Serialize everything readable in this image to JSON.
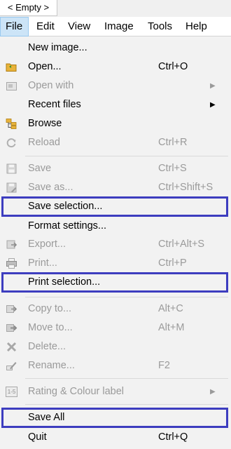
{
  "tab": {
    "label": "< Empty >"
  },
  "menubar": {
    "items": [
      {
        "label": "File"
      },
      {
        "label": "Edit"
      },
      {
        "label": "View"
      },
      {
        "label": "Image"
      },
      {
        "label": "Tools"
      },
      {
        "label": "Help"
      }
    ]
  },
  "file_menu": {
    "items": [
      {
        "label": "New image...",
        "shortcut": "",
        "enabled": true
      },
      {
        "label": "Open...",
        "shortcut": "Ctrl+O",
        "enabled": true,
        "icon": "folder-open-icon"
      },
      {
        "label": "Open with",
        "shortcut": "",
        "enabled": false,
        "submenu": true,
        "icon": "open-with-icon"
      },
      {
        "label": "Recent files",
        "shortcut": "",
        "enabled": true,
        "submenu": true
      },
      {
        "label": "Browse",
        "shortcut": "",
        "enabled": true,
        "icon": "browse-icon"
      },
      {
        "label": "Reload",
        "shortcut": "Ctrl+R",
        "enabled": false,
        "icon": "reload-icon"
      },
      {
        "label": "Save",
        "shortcut": "Ctrl+S",
        "enabled": false,
        "icon": "save-icon"
      },
      {
        "label": "Save as...",
        "shortcut": "Ctrl+Shift+S",
        "enabled": false,
        "icon": "save-as-icon"
      },
      {
        "label": "Save selection...",
        "shortcut": "",
        "enabled": true,
        "highlighted": true
      },
      {
        "label": "Format settings...",
        "shortcut": "",
        "enabled": true
      },
      {
        "label": "Export...",
        "shortcut": "Ctrl+Alt+S",
        "enabled": false,
        "icon": "export-icon"
      },
      {
        "label": "Print...",
        "shortcut": "Ctrl+P",
        "enabled": false,
        "icon": "printer-icon"
      },
      {
        "label": "Print selection...",
        "shortcut": "",
        "enabled": true,
        "highlighted": true
      },
      {
        "label": "Copy to...",
        "shortcut": "Alt+C",
        "enabled": false,
        "icon": "copy-to-icon"
      },
      {
        "label": "Move to...",
        "shortcut": "Alt+M",
        "enabled": false,
        "icon": "move-to-icon"
      },
      {
        "label": "Delete...",
        "shortcut": "",
        "enabled": false,
        "icon": "delete-icon"
      },
      {
        "label": "Rename...",
        "shortcut": "F2",
        "enabled": false,
        "icon": "rename-icon"
      },
      {
        "label": "Rating & Colour label",
        "shortcut": "",
        "enabled": false,
        "submenu": true,
        "icon": "rating-icon"
      },
      {
        "label": "Save All",
        "shortcut": "",
        "enabled": true,
        "highlighted": true
      },
      {
        "label": "Quit",
        "shortcut": "Ctrl+Q",
        "enabled": true
      }
    ],
    "submenu_arrow": "▶",
    "rating_icon_text": "1-5"
  },
  "colors": {
    "highlight_border": "#3d3dbf",
    "active_menu_bg": "#cce4f7",
    "disabled_text": "#9a9a9a",
    "folder_icon": "#e8b33a"
  }
}
